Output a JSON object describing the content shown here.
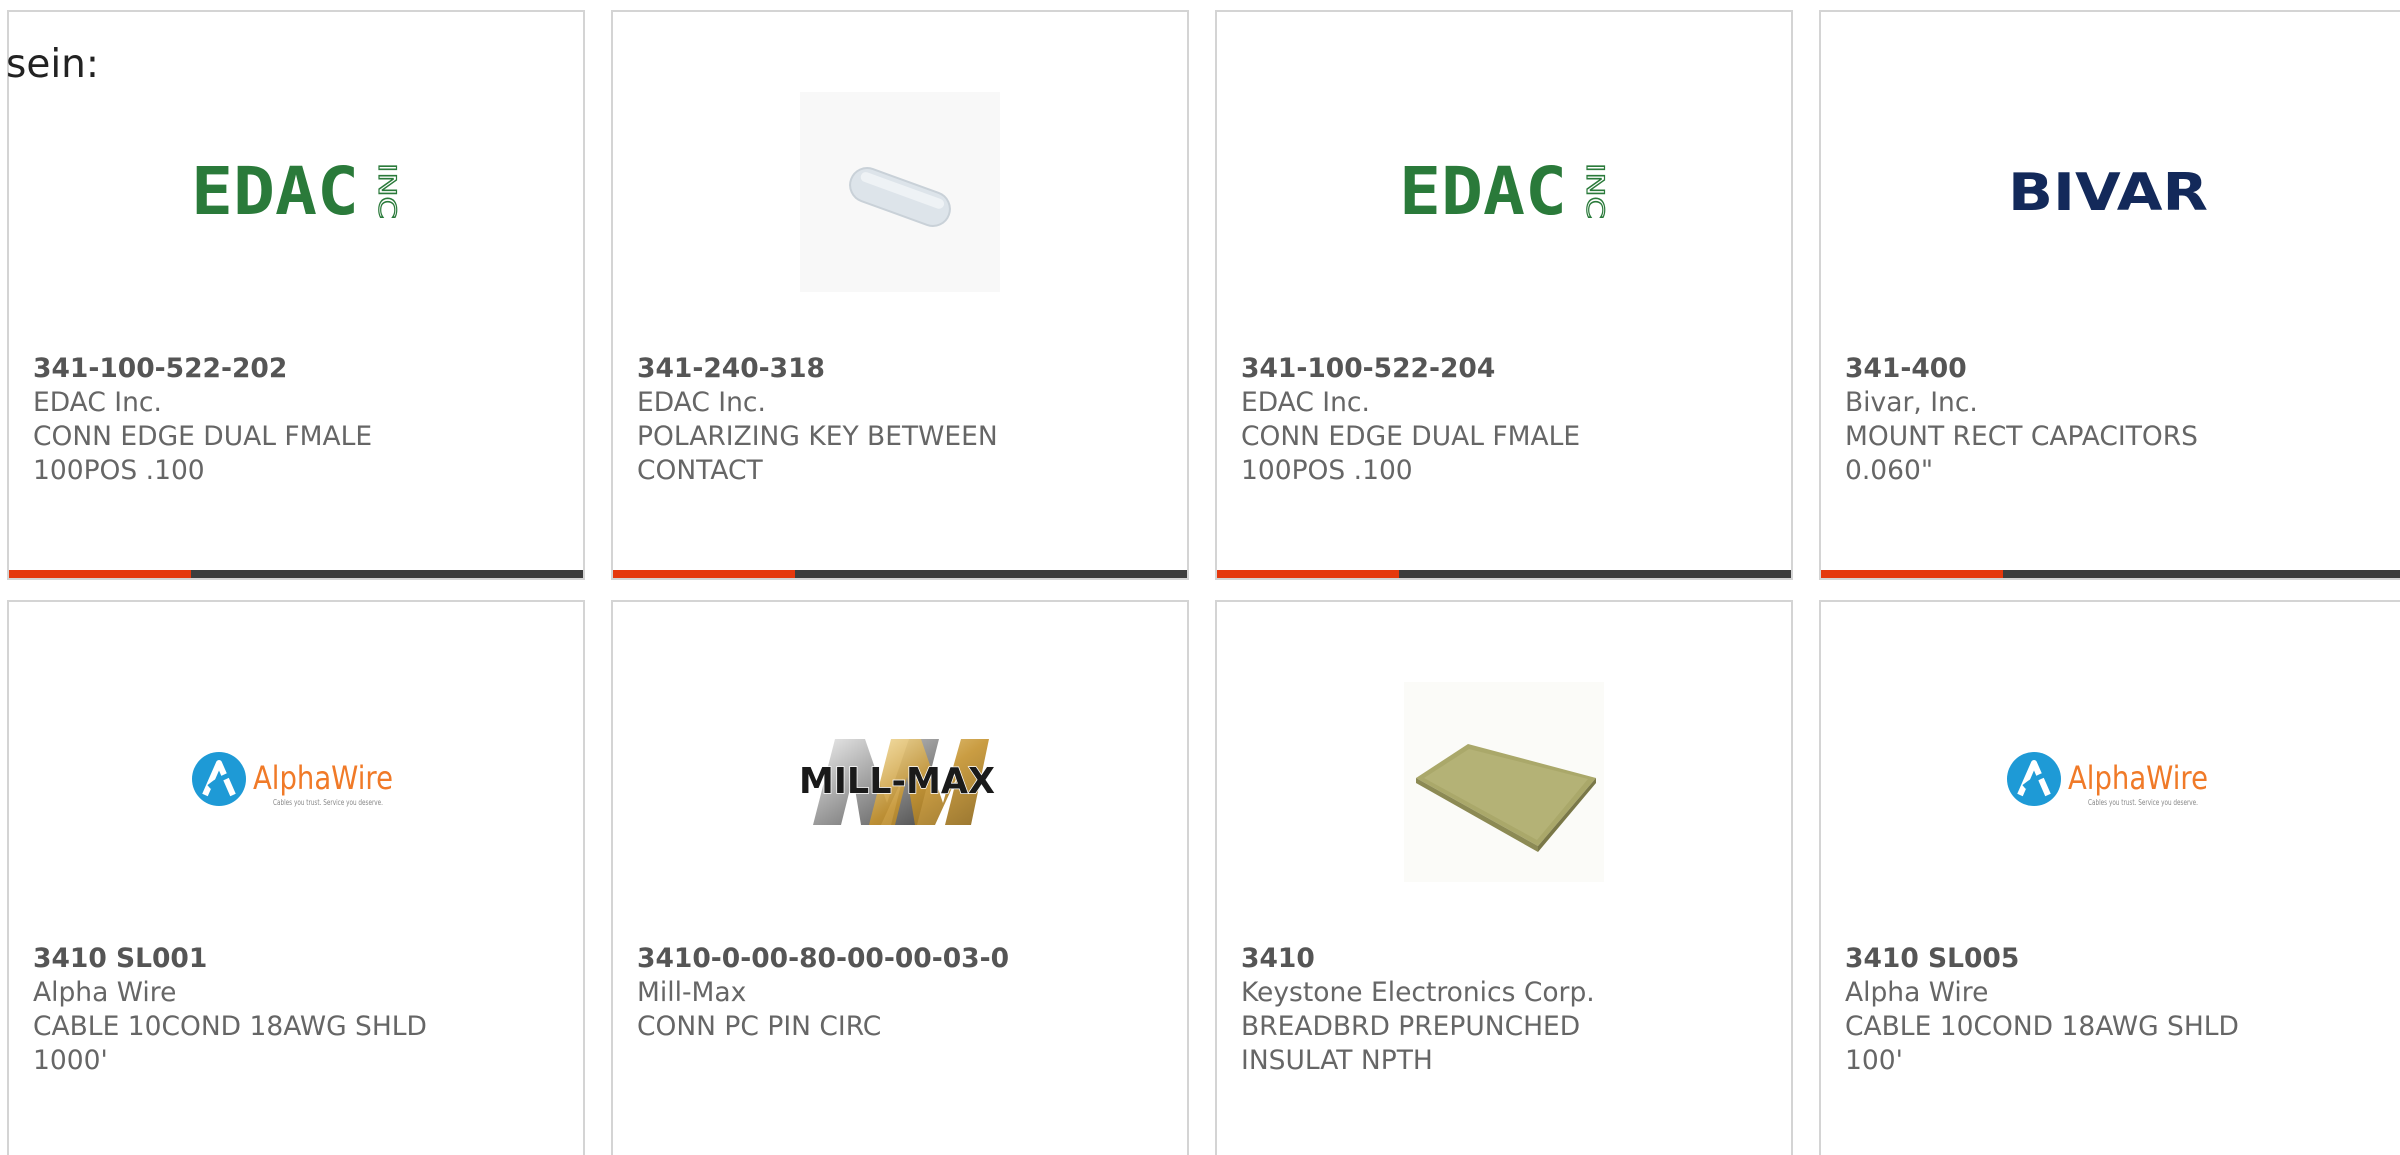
{
  "lead_text": "sein:",
  "colors": {
    "accent": "#e5380d",
    "bar": "#3d3d3d",
    "border": "#d4d4d4",
    "text": "#666666"
  },
  "products": [
    {
      "part_number": "341-100-522-202",
      "manufacturer": "EDAC Inc.",
      "description": "CONN EDGE DUAL FMALE 100POS .100",
      "image": "edac-logo"
    },
    {
      "part_number": "341-240-318",
      "manufacturer": "EDAC Inc.",
      "description": "POLARIZING KEY BETWEEN CONTACT",
      "image": "polarizing-key-photo"
    },
    {
      "part_number": "341-100-522-204",
      "manufacturer": "EDAC Inc.",
      "description": "CONN EDGE DUAL FMALE 100POS .100",
      "image": "edac-logo"
    },
    {
      "part_number": "341-400",
      "manufacturer": "Bivar, Inc.",
      "description": "MOUNT RECT CAPACITORS 0.060\"",
      "image": "bivar-logo"
    },
    {
      "part_number": "3410 SL001",
      "manufacturer": "Alpha Wire",
      "description": "CABLE 10COND 18AWG SHLD 1000'",
      "image": "alphawire-logo"
    },
    {
      "part_number": "3410-0-00-80-00-00-03-0",
      "manufacturer": "Mill-Max",
      "description": "CONN PC PIN CIRC",
      "image": "millmax-logo"
    },
    {
      "part_number": "3410",
      "manufacturer": "Keystone Electronics Corp.",
      "description": "BREADBRD PREPUNCHED INSULAT NPTH",
      "image": "breadboard-photo"
    },
    {
      "part_number": "3410 SL005",
      "manufacturer": "Alpha Wire",
      "description": "CABLE 10COND 18AWG SHLD 100'",
      "image": "alphawire-logo"
    }
  ],
  "logos": {
    "edac": {
      "main": "EDAC",
      "side": "INC"
    },
    "bivar": "BIVAR",
    "alphawire": {
      "name": "AlphaWire",
      "tagline": "Cables you trust. Service you deserve."
    },
    "millmax": "MILL-MAX"
  }
}
